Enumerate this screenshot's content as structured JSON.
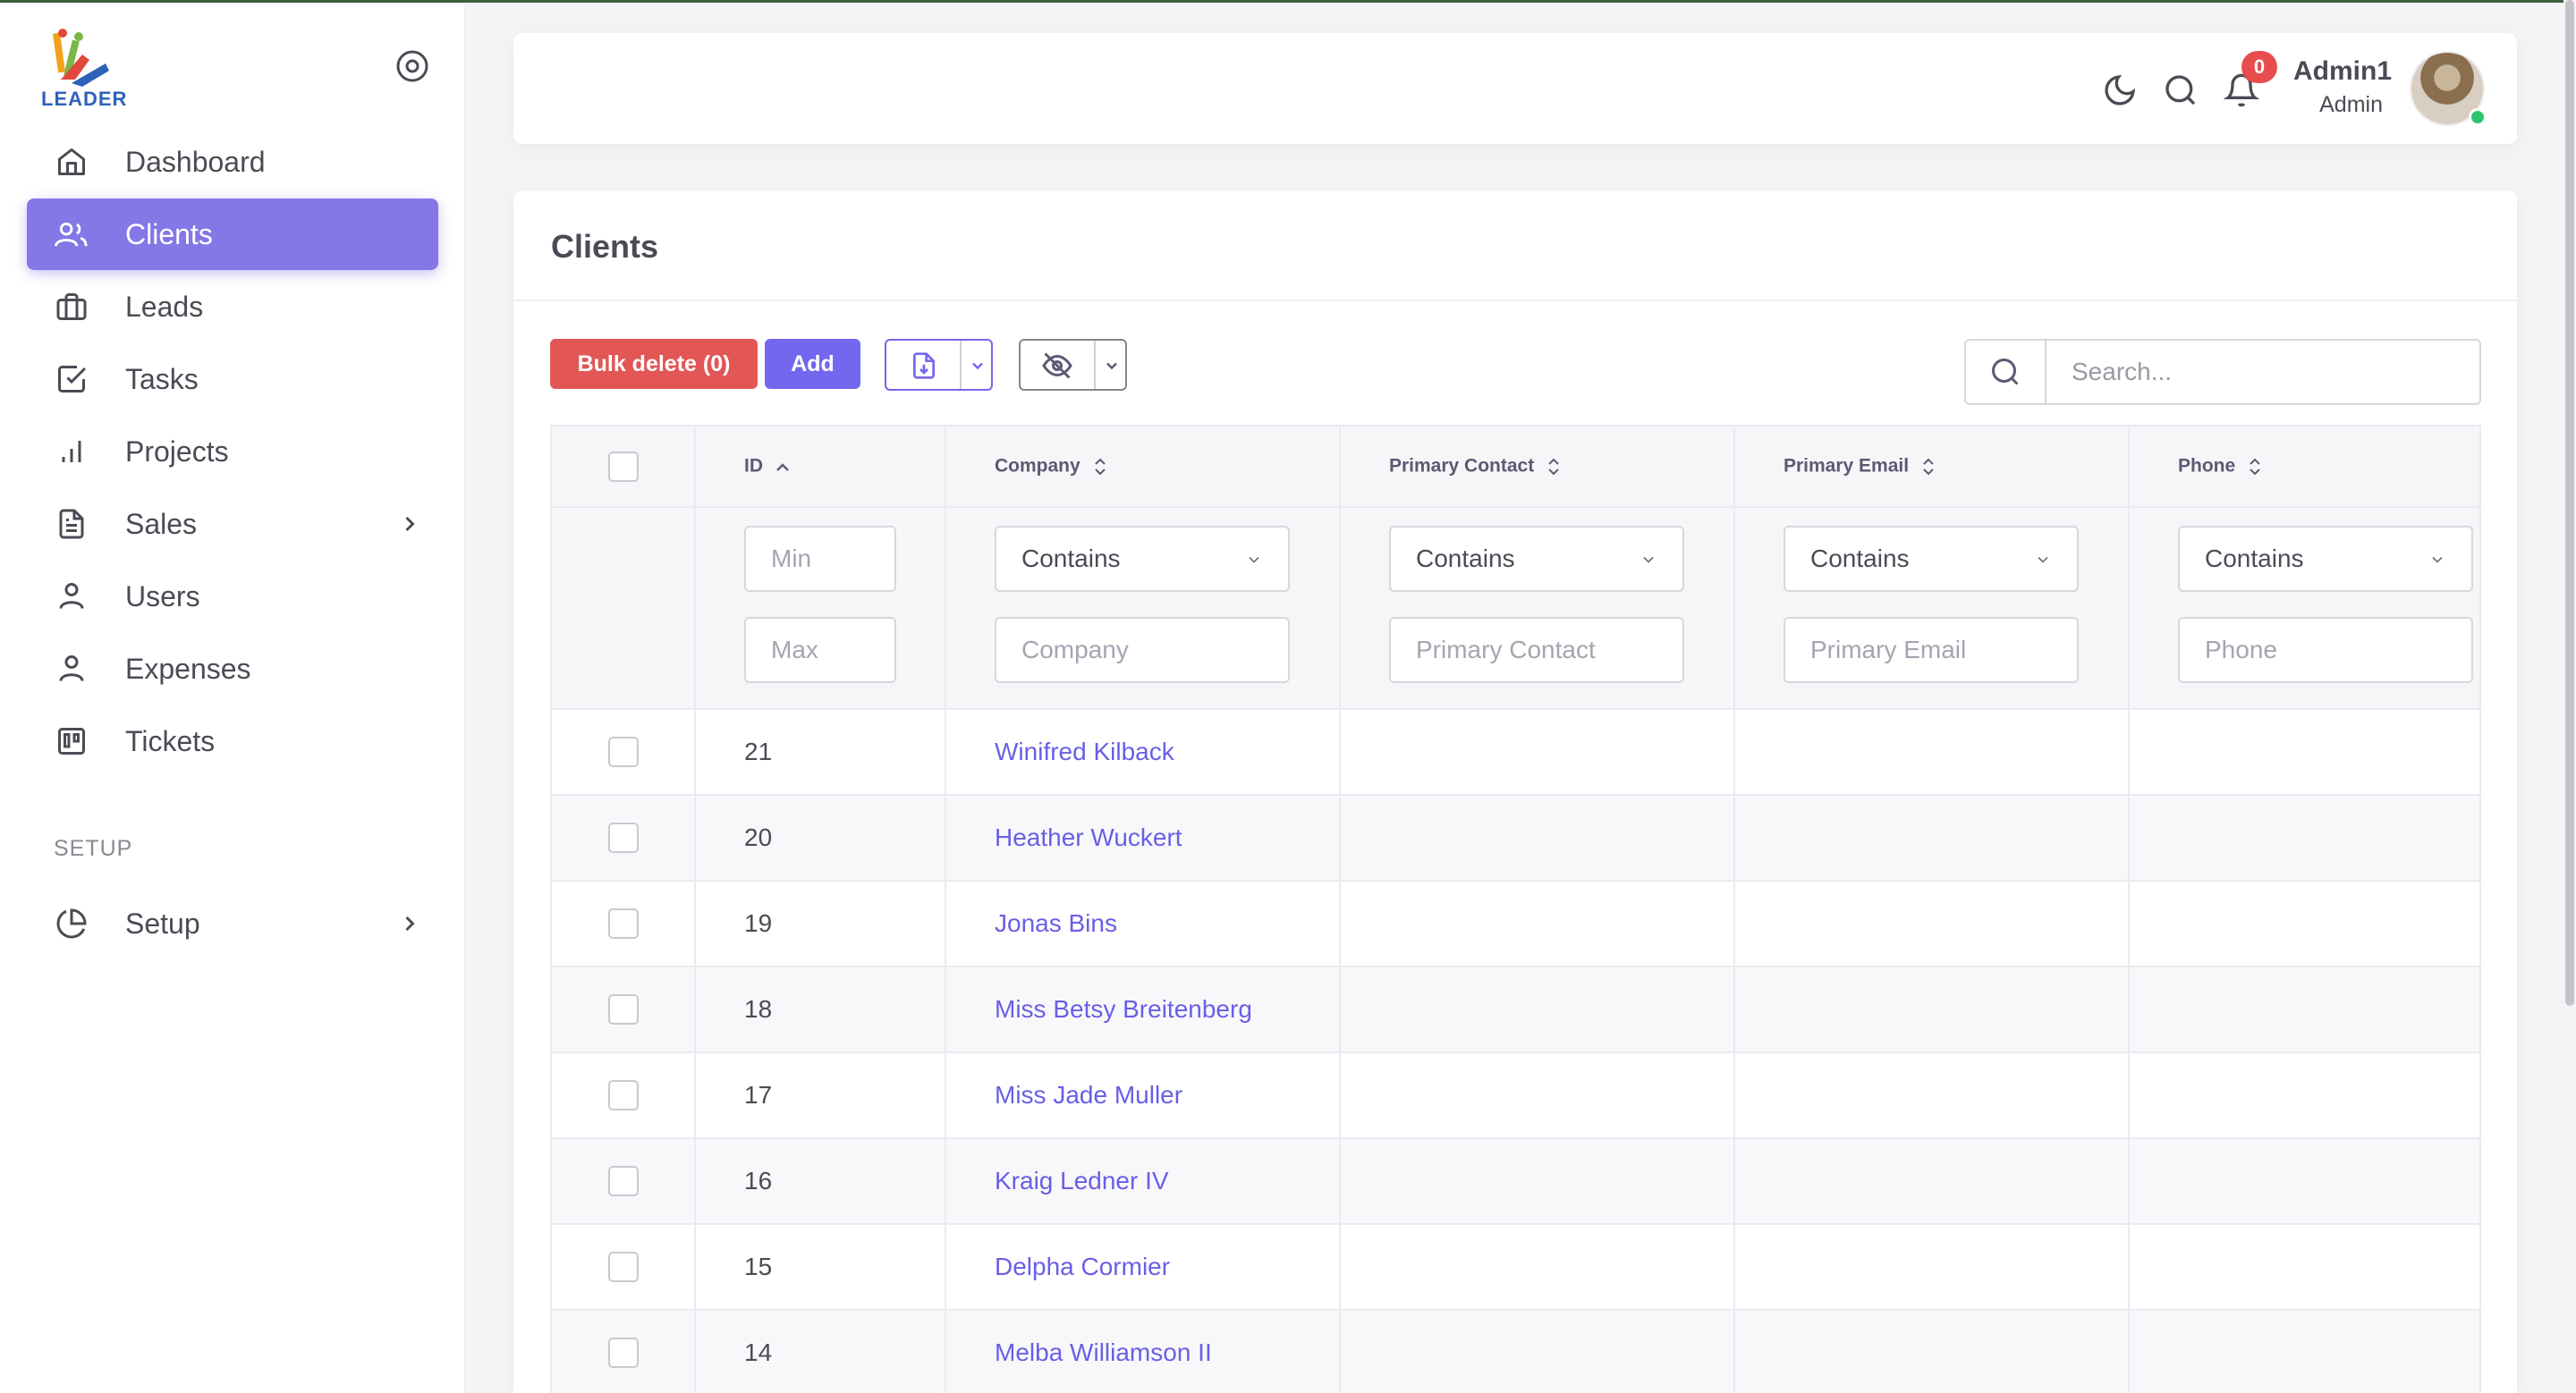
{
  "app": {
    "logo_text": "LEADER"
  },
  "sidebar": {
    "items": [
      {
        "label": "Dashboard",
        "icon": "home-icon"
      },
      {
        "label": "Clients",
        "icon": "users-icon",
        "active": true
      },
      {
        "label": "Leads",
        "icon": "briefcase-icon"
      },
      {
        "label": "Tasks",
        "icon": "check-square-icon"
      },
      {
        "label": "Projects",
        "icon": "bar-chart-icon"
      },
      {
        "label": "Sales",
        "icon": "file-text-icon",
        "expandable": true
      },
      {
        "label": "Users",
        "icon": "user-icon"
      },
      {
        "label": "Expenses",
        "icon": "user-icon"
      },
      {
        "label": "Tickets",
        "icon": "trello-icon"
      }
    ],
    "section_label": "SETUP",
    "setup": {
      "label": "Setup",
      "icon": "pie-chart-icon",
      "expandable": true
    }
  },
  "header": {
    "notifications_count": "0",
    "user_name": "Admin1",
    "user_role": "Admin"
  },
  "page": {
    "title": "Clients",
    "bulk_delete_label": "Bulk delete (0)",
    "add_label": "Add",
    "search_placeholder": "Search..."
  },
  "table": {
    "columns": [
      "ID",
      "Company",
      "Primary Contact",
      "Primary Email",
      "Phone"
    ],
    "filters": {
      "id_min_placeholder": "Min",
      "id_max_placeholder": "Max",
      "select_value": "Contains",
      "company_placeholder": "Company",
      "contact_placeholder": "Primary Contact",
      "email_placeholder": "Primary Email",
      "phone_placeholder": "Phone"
    },
    "rows": [
      {
        "id": "21",
        "company": "Winifred Kilback",
        "contact": "",
        "email": "",
        "phone": ""
      },
      {
        "id": "20",
        "company": "Heather Wuckert",
        "contact": "",
        "email": "",
        "phone": ""
      },
      {
        "id": "19",
        "company": "Jonas Bins",
        "contact": "",
        "email": "",
        "phone": ""
      },
      {
        "id": "18",
        "company": "Miss Betsy Breitenberg",
        "contact": "",
        "email": "",
        "phone": ""
      },
      {
        "id": "17",
        "company": "Miss Jade Muller",
        "contact": "",
        "email": "",
        "phone": ""
      },
      {
        "id": "16",
        "company": "Kraig Ledner IV",
        "contact": "",
        "email": "",
        "phone": ""
      },
      {
        "id": "15",
        "company": "Delpha Cormier",
        "contact": "",
        "email": "",
        "phone": ""
      },
      {
        "id": "14",
        "company": "Melba Williamson II",
        "contact": "",
        "email": "",
        "phone": ""
      }
    ]
  },
  "colors": {
    "accent": "#7367f0",
    "active_nav": "#8577e6",
    "danger": "#e25656",
    "online": "#28c76f"
  }
}
